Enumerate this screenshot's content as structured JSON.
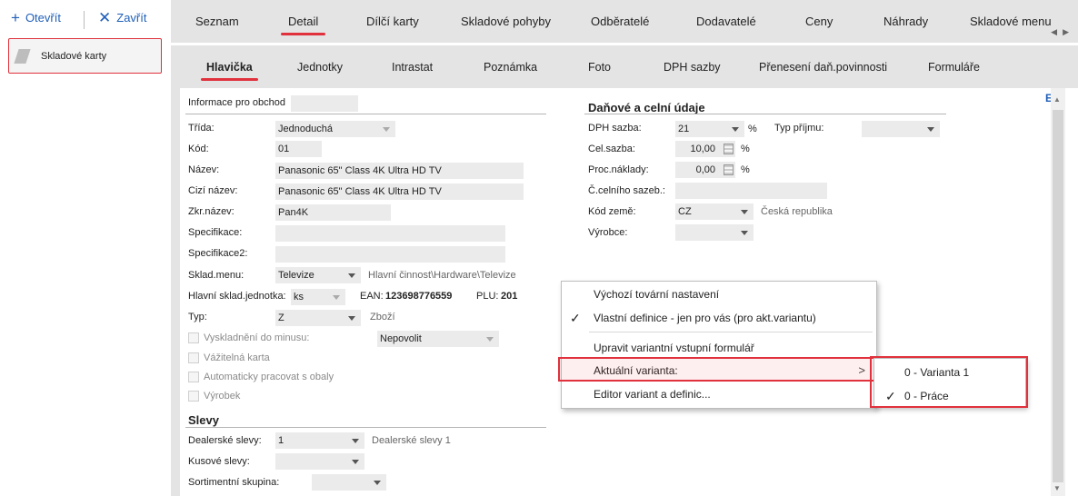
{
  "left_toolbar": {
    "open_label": "Otevřít",
    "close_label": "Zavřít"
  },
  "left_panel": {
    "item_label": "Skladové karty"
  },
  "tabs": [
    "Seznam",
    "Detail",
    "Dílčí karty",
    "Skladové pohyby",
    "Odběratelé",
    "Dodavatelé",
    "Ceny",
    "Náhrady",
    "Skladové menu"
  ],
  "active_tab": "Detail",
  "subtabs": [
    "Hlavička",
    "Jednotky",
    "Intrastat",
    "Poznámka",
    "Foto",
    "DPH sazby",
    "Přenesení daň.povinnosti",
    "Formuláře"
  ],
  "active_subtab": "Hlavička",
  "form": {
    "info_label": "Informace pro obchod",
    "trida_label": "Třída:",
    "trida_value": "Jednoduchá",
    "kod_label": "Kód:",
    "kod_value": "01",
    "nazev_label": "Název:",
    "nazev_value": "Panasonic 65\" Class 4K Ultra HD TV",
    "cizi_label": "Cizí název:",
    "cizi_value": "Panasonic 65\" Class 4K Ultra HD TV",
    "zkr_label": "Zkr.název:",
    "zkr_value": "Pan4K",
    "spec_label": "Specifikace:",
    "spec2_label": "Specifikace2:",
    "sklad_menu_label": "Sklad.menu:",
    "sklad_menu_value": "Televize",
    "sklad_menu_path": "Hlavní činnost\\Hardware\\Televize",
    "jednotka_label": "Hlavní sklad.jednotka:",
    "jednotka_value": "ks",
    "ean_label": "EAN:",
    "ean_value": "123698776559",
    "plu_label": "PLU:",
    "plu_value": "201",
    "typ_label": "Typ:",
    "typ_value": "Z",
    "typ_hint": "Zboží",
    "vysk_label": "Vyskladnění do minusu:",
    "vysk_value": "Nepovolit",
    "vazitelna_label": "Vážitelná karta",
    "auto_label": "Automaticky pracovat s obaly",
    "vyrobek_label": "Výrobek"
  },
  "slevy": {
    "title": "Slevy",
    "dealer_label": "Dealerské slevy:",
    "dealer_value": "1",
    "dealer_hint": "Dealerské slevy 1",
    "kusove_label": "Kusové slevy:",
    "sortiment_label": "Sortimentní skupina:"
  },
  "dan": {
    "title": "Daňové a celní údaje",
    "dph_label": "DPH sazba:",
    "dph_value": "21",
    "pct": "%",
    "typ_prijmu_label": "Typ příjmu:",
    "cel_label": "Cel.sazba:",
    "cel_value": "10,00",
    "proc_label": "Proc.náklady:",
    "proc_value": "0,00",
    "celni_label": "Č.celního sazeb.:",
    "zeme_label": "Kód země:",
    "zeme_value": "CZ",
    "zeme_hint": "Česká republika",
    "vyrobce_label": "Výrobce:"
  },
  "context_menu": {
    "items": [
      "Výchozí tovární nastavení",
      "Vlastní definice - jen pro vás (pro akt.variantu)",
      "Upravit variantní vstupní formulář",
      "Aktuální varianta:",
      "Editor variant a definic..."
    ],
    "checkmark": "✓",
    "arrow": ">"
  },
  "submenu": {
    "items": [
      "0 - Varianta 1",
      "0 - Práce"
    ]
  },
  "misc": {
    "e_button": "E"
  },
  "colors": {
    "accent": "#e0313c",
    "link": "#1f5fb8",
    "tabbar": "#e4e4e4"
  }
}
